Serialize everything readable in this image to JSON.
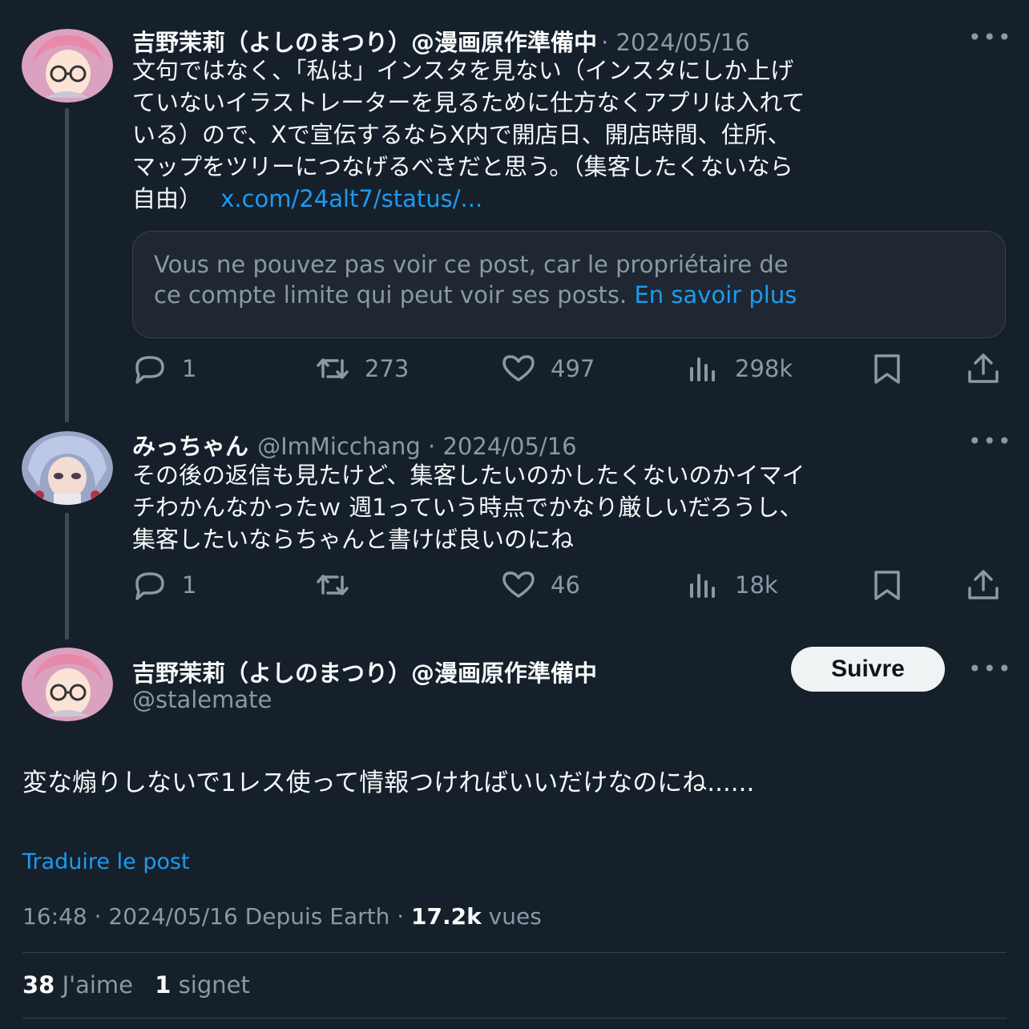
{
  "tweet1": {
    "name": "吉野茉莉（よしのまつり）@漫画原作準備中",
    "date": "· 2024/05/16",
    "lines": [
      "文句ではなく、「私は」インスタを見ない（インスタにしか上げ",
      "ていないイラストレーターを見るために仕方なくアプリは入れて",
      "いる）ので、Xで宣伝するならX内で開店日、開店時間、住所、",
      "マップをツリーにつなげるべきだと思う。（集客したくないなら"
    ],
    "last_line": "自由）",
    "link": "x.com/24alt7/status/...",
    "quote_line1": "Vous ne pouvez pas voir ce post, car le propriétaire de",
    "quote_line2": "ce compte limite qui peut voir ses posts.",
    "quote_link": "En savoir plus",
    "replies": "1",
    "reposts": "273",
    "likes": "497",
    "views": "298k"
  },
  "tweet2": {
    "name": "みっちゃん",
    "handle_date": "@ImMicchang · 2024/05/16",
    "lines": [
      "その後の返信も見たけど、集客したいのかしたくないのかイマイ",
      "チわかんなかったｗ 週1っていう時点でかなり厳しいだろうし、",
      "集客したいならちゃんと書けば良いのにね"
    ],
    "replies": "1",
    "reposts": "",
    "likes": "46",
    "views": "18k"
  },
  "main": {
    "name": "吉野茉莉（よしのまつり）@漫画原作準備中",
    "handle": "@stalemate",
    "follow_label": "Suivre",
    "text": "変な煽りしないで1レス使って情報つければいいだけなのにね......",
    "translate": "Traduire le post",
    "time_date": "16:48 · 2024/05/16 Depuis Earth ·",
    "views_count": "17.2k",
    "views_label": "vues",
    "likes_count": "38",
    "likes_label": "J'aime",
    "bookmarks_count": "1",
    "bookmarks_label": "signet"
  },
  "colors": {
    "background": "#15202b",
    "text": "#f7f9f9",
    "muted": "#8b98a5",
    "link": "#1d9bf0"
  },
  "icons": [
    "reply-icon",
    "repost-icon",
    "like-icon",
    "views-icon",
    "bookmark-icon",
    "share-icon",
    "more-icon"
  ]
}
